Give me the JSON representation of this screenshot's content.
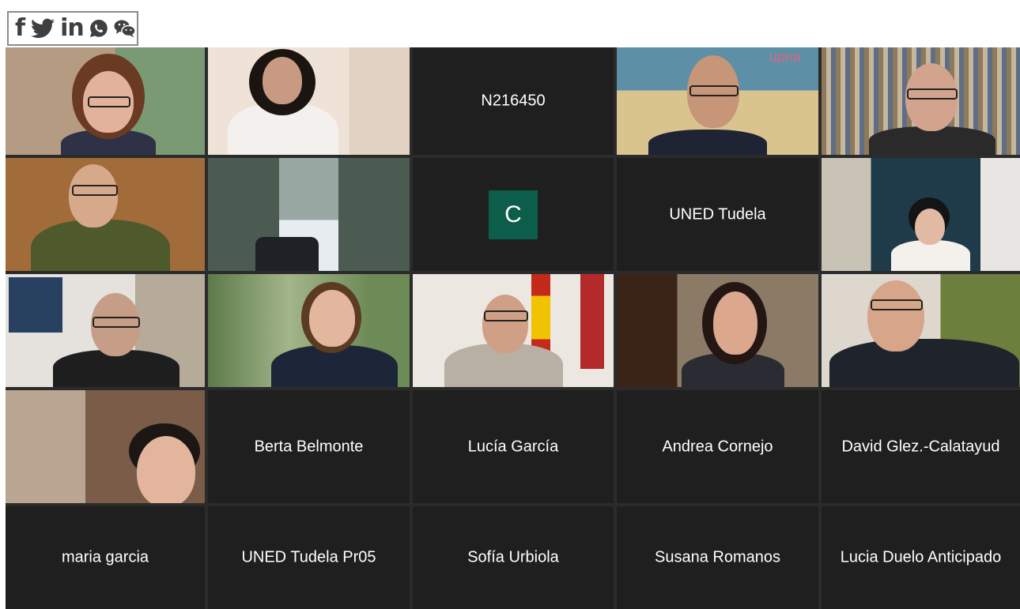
{
  "share_bar": {
    "icons": [
      "facebook-icon",
      "twitter-icon",
      "linkedin-icon",
      "whatsapp-icon",
      "wechat-icon"
    ],
    "facebook_glyph": "f",
    "linkedin_glyph": "in"
  },
  "meeting": {
    "colors": {
      "tile_bg": "#1f1f1f",
      "avatar_bg": "#0c5d4a",
      "active_speaker": "#c9d64a"
    },
    "tiles": [
      {
        "type": "video"
      },
      {
        "type": "video"
      },
      {
        "type": "name",
        "label": "N216450"
      },
      {
        "type": "video",
        "watermark": "upna"
      },
      {
        "type": "video"
      },
      {
        "type": "video"
      },
      {
        "type": "video"
      },
      {
        "type": "avatar",
        "initial": "C"
      },
      {
        "type": "name",
        "label": "UNED Tudela"
      },
      {
        "type": "video"
      },
      {
        "type": "video"
      },
      {
        "type": "video"
      },
      {
        "type": "video"
      },
      {
        "type": "video"
      },
      {
        "type": "video",
        "active": true
      },
      {
        "type": "video"
      },
      {
        "type": "name",
        "label": "Berta Belmonte"
      },
      {
        "type": "name",
        "label": "Lucía García"
      },
      {
        "type": "name",
        "label": "Andrea Cornejo"
      },
      {
        "type": "name",
        "label": "David Glez.-Calatayud"
      },
      {
        "type": "name",
        "label": "maria garcia"
      },
      {
        "type": "name",
        "label": "UNED Tudela Pr05"
      },
      {
        "type": "name",
        "label": "Sofía Urbiola"
      },
      {
        "type": "name",
        "label": "Susana Romanos"
      },
      {
        "type": "name",
        "label": "Lucia Duelo Anticipado"
      }
    ]
  }
}
